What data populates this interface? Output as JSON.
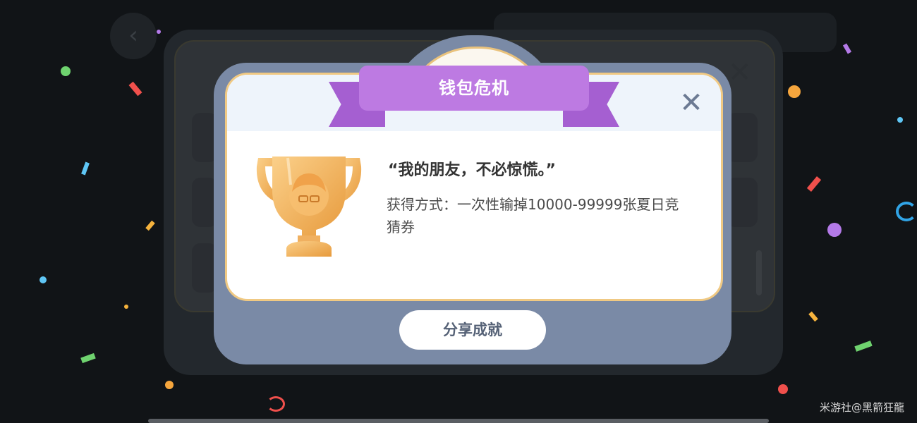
{
  "dialog": {
    "title": "钱包危机",
    "quote": "“我的朋友，不必惊慌。”",
    "description": "获得方式：一次性输掉10000-99999张夏日竞猜券",
    "share_label": "分享成就",
    "close_icon": "close-icon"
  },
  "background": {
    "back_icon": "back-arrow-icon"
  },
  "watermark": "米游社@黑箭狂龍",
  "colors": {
    "ribbon": "#bd7ae2",
    "dialog_frame": "#7a8aa6",
    "card_border": "#f0c983",
    "trophy_gold": "#f2b25c"
  }
}
